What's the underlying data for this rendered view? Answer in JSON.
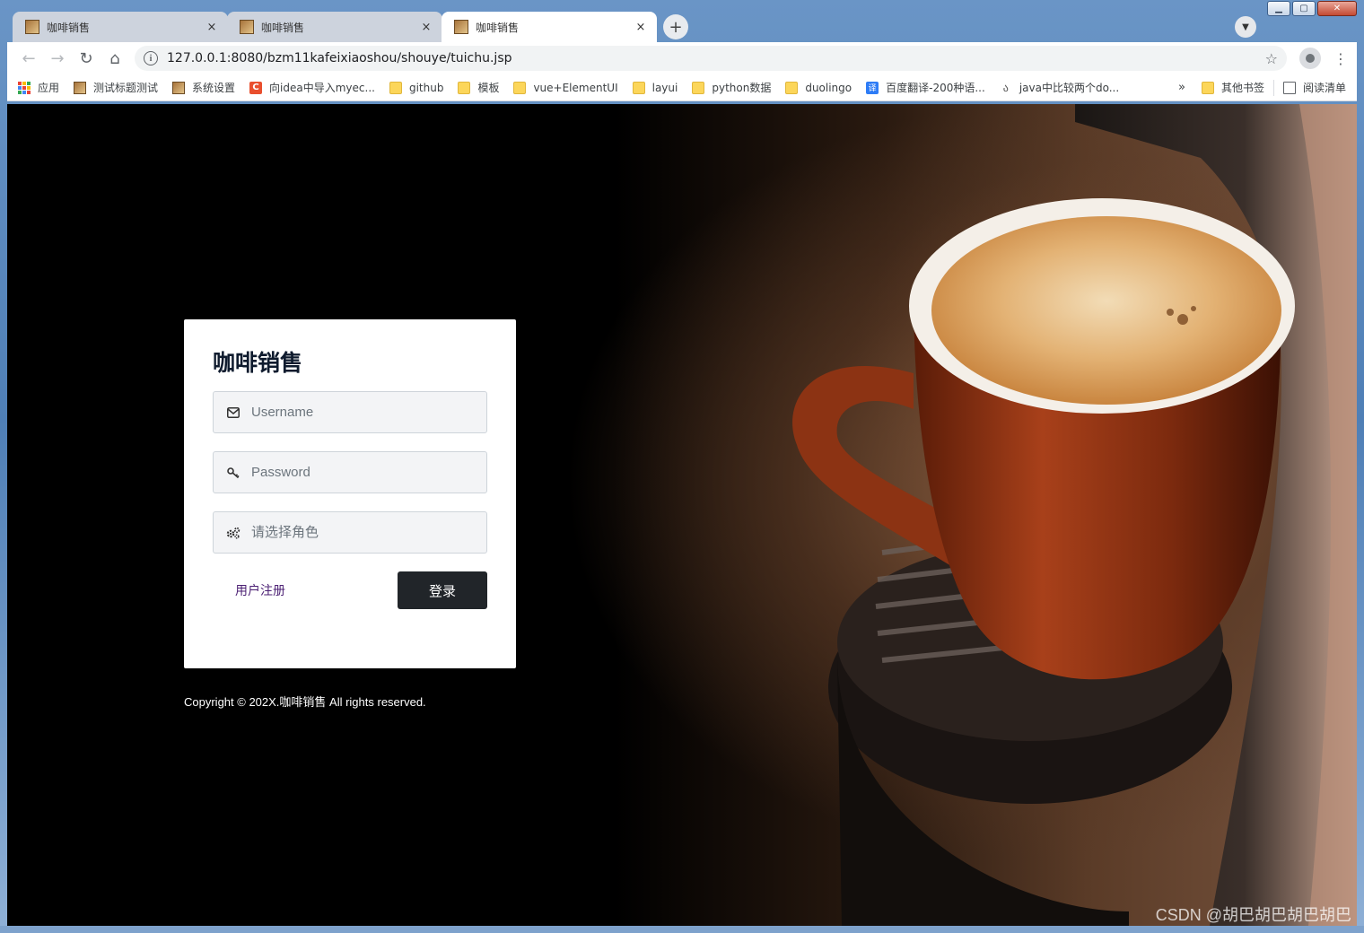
{
  "browser": {
    "tabs": [
      {
        "title": "咖啡销售",
        "state": "inactive"
      },
      {
        "title": "咖啡销售",
        "state": "inactive"
      },
      {
        "title": "咖啡销售",
        "state": "active"
      }
    ],
    "new_tab_icon": "+",
    "close_icon": "×",
    "url": "127.0.0.1:8080/bzm11kafeixiaoshou/shouye/tuichu.jsp",
    "bookmarks": [
      {
        "label": "应用",
        "icon": "apps-icon"
      },
      {
        "label": "测试标题测试",
        "icon": "site-icon"
      },
      {
        "label": "系统设置",
        "icon": "site-icon"
      },
      {
        "label": "向idea中导入myec...",
        "icon": "c-icon"
      },
      {
        "label": "github",
        "icon": "folder-icon"
      },
      {
        "label": "模板",
        "icon": "folder-icon"
      },
      {
        "label": "vue+ElementUI",
        "icon": "folder-icon"
      },
      {
        "label": "layui",
        "icon": "folder-icon"
      },
      {
        "label": "python数据",
        "icon": "folder-icon"
      },
      {
        "label": "duolingo",
        "icon": "folder-icon"
      },
      {
        "label": "百度翻译-200种语...",
        "icon": "translate-icon"
      },
      {
        "label": "java中比较两个do...",
        "icon": "java-icon"
      }
    ],
    "bookmarks_more": "»",
    "other_bookmarks": "其他书签",
    "reading_list": "阅读清单"
  },
  "login": {
    "title": "咖啡销售",
    "username_placeholder": "Username",
    "password_placeholder": "Password",
    "role_placeholder": "请选择角色",
    "register_link": "用户注册",
    "login_button": "登录"
  },
  "footer": {
    "copyright": "Copyright © 202X.咖啡销售 All rights reserved."
  },
  "watermark": "CSDN @胡巴胡巴胡巴胡巴",
  "colors": {
    "login_button_bg": "#212529",
    "register_link": "#4b1f73",
    "title": "#0f1b2e"
  }
}
